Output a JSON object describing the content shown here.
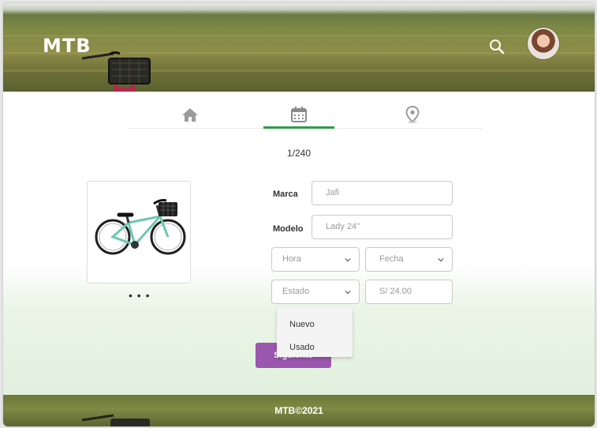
{
  "header": {
    "brand": "MTB",
    "search_icon": "search-icon",
    "avatar": "user-avatar"
  },
  "tabs": [
    {
      "icon": "home-icon",
      "active": false
    },
    {
      "icon": "calendar-icon",
      "active": true
    },
    {
      "icon": "location-pin-icon",
      "active": false
    }
  ],
  "gallery": {
    "counter": "1/240",
    "more": "• • •"
  },
  "form": {
    "marca_label": "Marca",
    "marca_value": "Jafi",
    "modelo_label": "Modelo",
    "modelo_value": "Lady 24''",
    "hora_value": "Hora",
    "fecha_value": "Fecha",
    "estado_value": "Estado",
    "precio_value": "S/ 24.00",
    "estado_options": [
      "Nuevo",
      "Usado"
    ],
    "submit_label": "Siguiente"
  },
  "footer": {
    "text": "MTB©2021"
  },
  "colors": {
    "accent_green": "#2e9a47",
    "button_purple": "#9b56ae"
  }
}
